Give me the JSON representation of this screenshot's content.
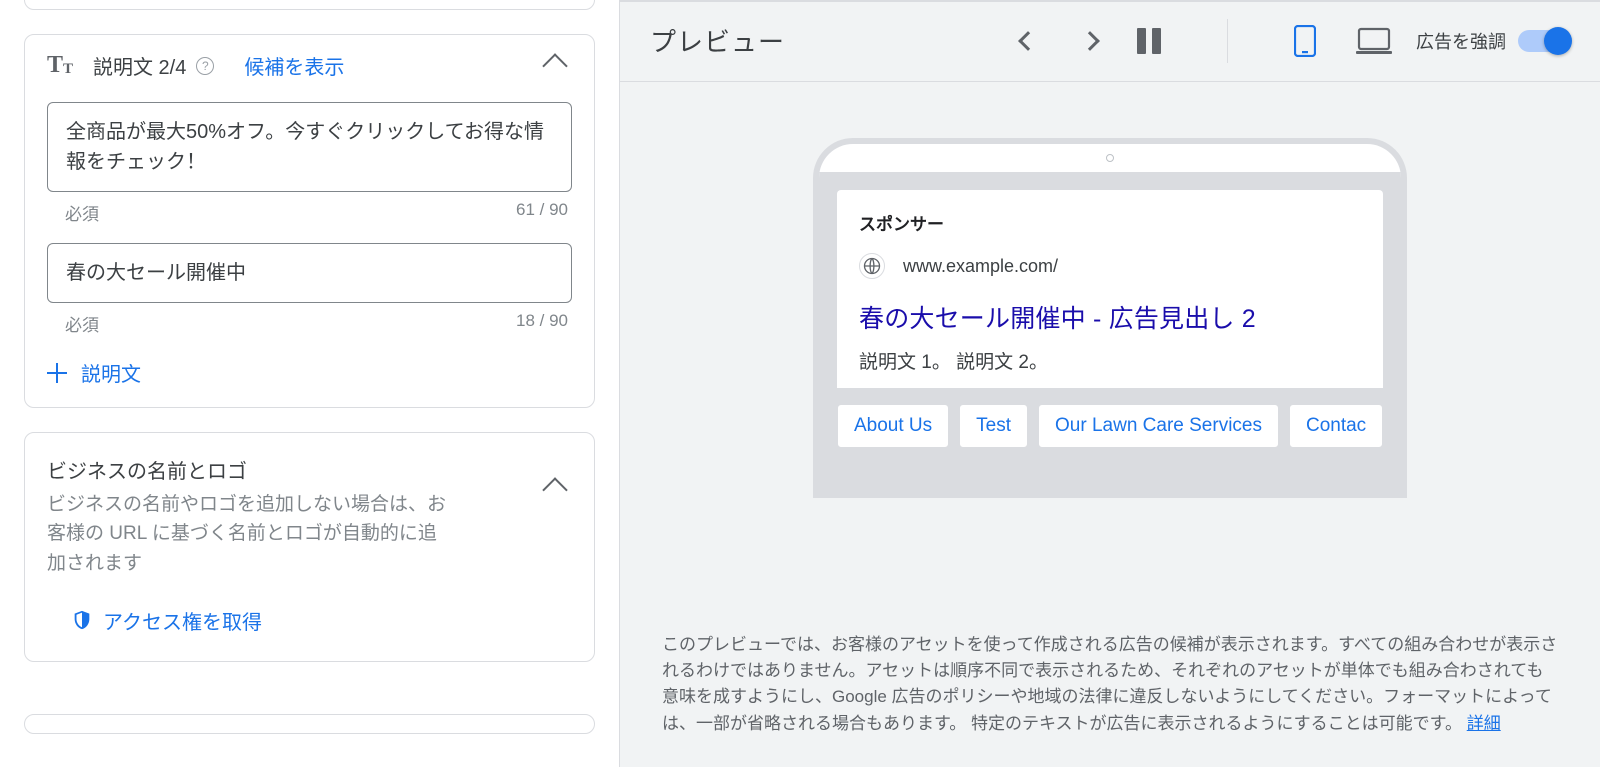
{
  "descriptions": {
    "section_title": "説明文 2/4",
    "show_suggestions": "候補を表示",
    "fields": [
      {
        "value": "全商品が最大50%オフ。今すぐクリックしてお得な情報をチェック！",
        "required_label": "必須",
        "counter": "61 / 90"
      },
      {
        "value": "春の大セール開催中",
        "required_label": "必須",
        "counter": "18 / 90"
      }
    ],
    "add_label": "説明文"
  },
  "business": {
    "title": "ビジネスの名前とロゴ",
    "subtitle": "ビジネスの名前やロゴを追加しない場合は、お客様の URL に基づく名前とロゴが自動的に追加されます",
    "access_link": "アクセス権を取得"
  },
  "preview": {
    "title": "プレビュー",
    "highlight_label": "広告を強調",
    "ad": {
      "sponsor": "スポンサー",
      "url": "www.example.com/",
      "headline": "春の大セール開催中 - 広告見出し 2",
      "description": "説明文 1。 説明文 2。",
      "sitelinks": [
        "About Us",
        "Test",
        "Our Lawn Care Services",
        "Contac"
      ]
    },
    "footnote": "このプレビューでは、お客様のアセットを使って作成される広告の候補が表示されます。すべての組み合わせが表示されるわけではありません。アセットは順序不同で表示されるため、それぞれのアセットが単体でも組み合わされても意味を成すようにし、Google 広告のポリシーや地域の法律に違反しないようにしてください。フォーマットによっては、一部が省略される場合もあります。 特定のテキストが広告に表示されるようにすることは可能です。 ",
    "details_link": "詳細"
  }
}
